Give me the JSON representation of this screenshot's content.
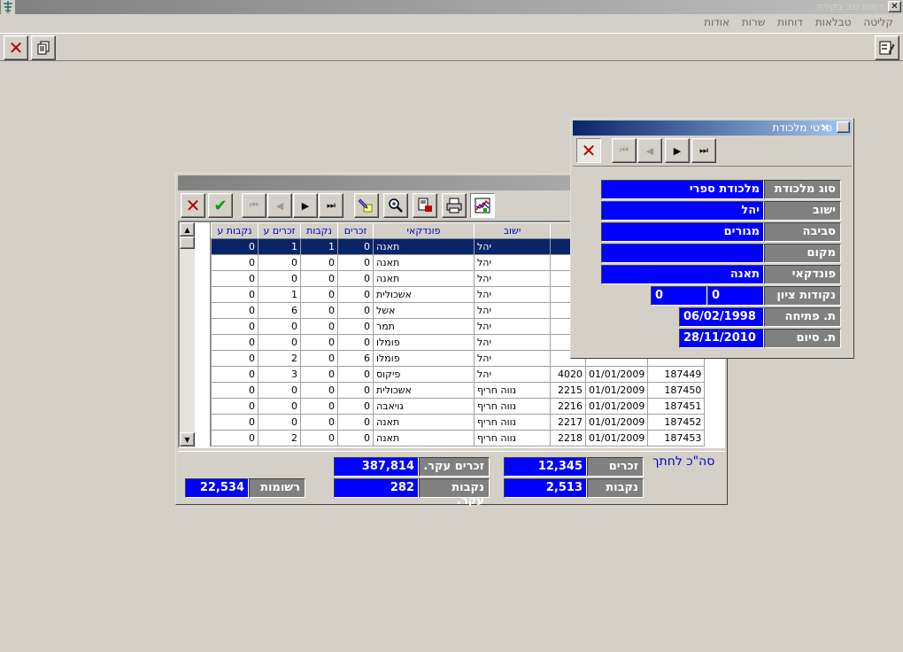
{
  "app": {
    "title": "דמות נגב בקירה",
    "close_label": "✕"
  },
  "menu": [
    "קליטה",
    "טבלאות",
    "דוחות",
    "שרות",
    "אודות"
  ],
  "grid": {
    "columns": [
      "ישוב",
      "פונדקאי",
      "זכרים",
      "נקבות",
      "זכרים ע",
      "נקבות ע"
    ],
    "rows": [
      {
        "code": "",
        "date": "",
        "num": "",
        "settlement": "יהל",
        "host": "תאנה",
        "males": "0",
        "females": "1",
        "males_e": "1",
        "females_e": "0"
      },
      {
        "code": "",
        "date": "",
        "num": "",
        "settlement": "יהל",
        "host": "תאנה",
        "males": "0",
        "females": "0",
        "males_e": "0",
        "females_e": "0"
      },
      {
        "code": "",
        "date": "",
        "num": "",
        "settlement": "יהל",
        "host": "תאנה",
        "males": "0",
        "females": "0",
        "males_e": "0",
        "females_e": "0"
      },
      {
        "code": "",
        "date": "",
        "num": "",
        "settlement": "יהל",
        "host": "אשכולית",
        "males": "0",
        "females": "0",
        "males_e": "1",
        "females_e": "0"
      },
      {
        "code": "",
        "date": "",
        "num": "",
        "settlement": "יהל",
        "host": "אשל",
        "males": "0",
        "females": "0",
        "males_e": "6",
        "females_e": "0"
      },
      {
        "code": "",
        "date": "",
        "num": "",
        "settlement": "יהל",
        "host": "תמר",
        "males": "0",
        "females": "0",
        "males_e": "0",
        "females_e": "0"
      },
      {
        "code": "",
        "date": "",
        "num": "",
        "settlement": "יהל",
        "host": "פומלו",
        "males": "0",
        "females": "0",
        "males_e": "0",
        "females_e": "0"
      },
      {
        "code": "",
        "date": "",
        "num": "",
        "settlement": "יהל",
        "host": "פומלו",
        "males": "6",
        "females": "0",
        "males_e": "2",
        "females_e": "0"
      },
      {
        "code": "187449",
        "date": "01/01/2009",
        "num": "4020",
        "settlement": "יהל",
        "host": "פיקוס",
        "males": "0",
        "females": "0",
        "males_e": "3",
        "females_e": "0"
      },
      {
        "code": "187450",
        "date": "01/01/2009",
        "num": "2215",
        "settlement": "נווה חריף",
        "host": "אשכולית",
        "males": "0",
        "females": "0",
        "males_e": "0",
        "females_e": "0"
      },
      {
        "code": "187451",
        "date": "01/01/2009",
        "num": "2216",
        "settlement": "נווה חריף",
        "host": "גויאבה",
        "males": "0",
        "females": "0",
        "males_e": "0",
        "females_e": "0"
      },
      {
        "code": "187452",
        "date": "01/01/2009",
        "num": "2217",
        "settlement": "נווה חריף",
        "host": "תאנה",
        "males": "0",
        "females": "0",
        "males_e": "0",
        "females_e": "0"
      },
      {
        "code": "187453",
        "date": "01/01/2009",
        "num": "2218",
        "settlement": "נווה חריף",
        "host": "תאנה",
        "males": "0",
        "females": "0",
        "males_e": "2",
        "females_e": "0"
      }
    ]
  },
  "summary": {
    "title": "סה\"כ לחתך",
    "males_label": "זכרים",
    "males_value": "12,345",
    "females_label": "נקבות",
    "females_value": "2,513",
    "males_main_label": "זכרים עקר.",
    "males_main_value": "387,814",
    "females_main_label": "נקבות עקר.",
    "females_main_value": "282",
    "records_label": "רשומות",
    "records_value": "22,534"
  },
  "detail": {
    "title": "פרטי מלכודת",
    "fields": {
      "trap_type_label": "סוג מלכודת",
      "trap_type_value": "מלכודת ספרי",
      "settlement_label": "ישוב",
      "settlement_value": "יהל",
      "environment_label": "סביבה",
      "environment_value": "מגורים",
      "location_label": "מקום",
      "location_value": "",
      "host_label": "פונדקאי",
      "host_value": "תאנה",
      "coords_label": "נקודות ציון",
      "coord_x": "0",
      "coord_y": "0",
      "open_date_label": "ת. פתיחה",
      "open_date_value": "06/02/1998",
      "end_date_label": "ת. סיום",
      "end_date_value": "28/11/2010"
    }
  },
  "icons": {
    "close": "✕",
    "check": "✔",
    "first": "⏮",
    "prev": "◀",
    "next": "▶",
    "last": "⏭",
    "scroll_up": "▲",
    "scroll_down": "▼"
  }
}
